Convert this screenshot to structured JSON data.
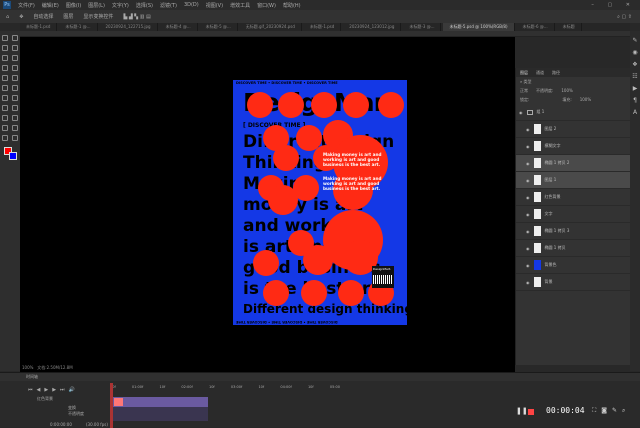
{
  "menu": [
    "文件(F)",
    "编辑(E)",
    "图像(I)",
    "图层(L)",
    "文字(Y)",
    "选择(S)",
    "滤镜(T)",
    "3D(D)",
    "视图(V)",
    "增效工具",
    "窗口(W)",
    "帮助(H)"
  ],
  "options": {
    "auto_select": "自动选择",
    "layer": "图层",
    "transform": "显示变换控件"
  },
  "tabs": [
    "未标题-1.psd",
    "未标题-1 @...",
    "20230924_122715.jpg",
    "未标题-4 @...",
    "未标题-5 @...",
    "无标题.gif_20230924.psd",
    "未标题-1.psd",
    "20230924_123012.jpg",
    "未标题-3 @...",
    "未标题-5.psd @ 100%(RGB/8)",
    "未标题-6 @...",
    "未标题"
  ],
  "active_tab_index": 9,
  "poster": {
    "headline": "DesignMart",
    "discover": "[ DISCOVER TIME ]",
    "border_text": "DISCOVER TIME • DISCOVER TIME • DISCOVER TIME",
    "lines": [
      "DifferentDesign",
      "Thinking",
      "Making",
      "money is art",
      "and working",
      "is art and",
      "good business",
      "is the best art"
    ],
    "bottom": "Different design thinking",
    "small1": "Making money is art and working is art and good business is the best art.",
    "small2": "Making money is art and working is art and good business is the best art.",
    "badge": "DesignMart.",
    "colors": {
      "bg": "#1438e6",
      "dots": "#ff2a14",
      "text": "#000000"
    }
  },
  "layers": {
    "tabs": [
      "图层",
      "通道",
      "路径"
    ],
    "filter": "类型",
    "blend": "正常",
    "opacity_label": "不透明度:",
    "opacity": "100%",
    "lock_label": "锁定:",
    "fill_label": "填充:",
    "fill": "100%",
    "items": [
      {
        "name": "组 1"
      },
      {
        "name": "图层 2"
      },
      {
        "name": "模糊文字"
      },
      {
        "name": "椭圆 1 拷贝 2"
      },
      {
        "name": "图层 1"
      },
      {
        "name": "红色背景"
      },
      {
        "name": "文字"
      },
      {
        "name": "椭圆 1 拷贝 3"
      },
      {
        "name": "椭圆 1 拷贝"
      },
      {
        "name": "背景色"
      },
      {
        "name": "背景"
      }
    ]
  },
  "status": {
    "zoom": "100%",
    "doc": "文档:2.50M/12.8M"
  },
  "timeline": {
    "title": "时间轴",
    "layer": "红色背景",
    "props": [
      "变换",
      "不透明度",
      "样式"
    ],
    "time": "0:00:00:00",
    "fps": "(30.00 fps)",
    "ticks": [
      "10f",
      "01:00f",
      "10f",
      "02:00f",
      "10f",
      "03:00f",
      "10f",
      "04:00f",
      "10f",
      "05:00"
    ]
  },
  "recorder": {
    "time": "00:00:04"
  }
}
